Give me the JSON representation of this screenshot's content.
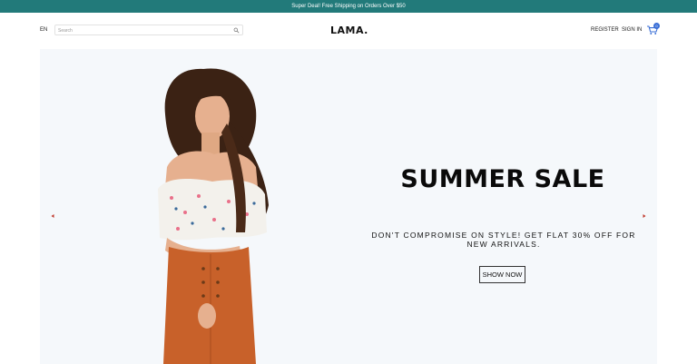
{
  "announcement": {
    "text": "Super Deal! Free Shipping on Orders Over $50"
  },
  "navbar": {
    "language": "EN",
    "search": {
      "placeholder": "Search",
      "value": ""
    },
    "logo": "LAMA.",
    "register_label": "REGISTER",
    "signin_label": "SIGN IN",
    "cart": {
      "icon": "shopping-cart-icon",
      "count": "0"
    }
  },
  "hero": {
    "title": "SUMMER SALE",
    "description": "DON'T COMPROMISE ON STYLE! GET FLAT 30% OFF FOR NEW ARRIVALS.",
    "button_label": "SHOW NOW",
    "background_color": "#f5f8fb",
    "arrows": {
      "left_icon": "arrow-left-icon",
      "right_icon": "arrow-right-icon",
      "color": "#c0392b"
    }
  },
  "colors": {
    "announcement_bg": "#227a7a",
    "badge_bg": "#3b6fd6",
    "cart_icon": "#3b6fd6"
  }
}
